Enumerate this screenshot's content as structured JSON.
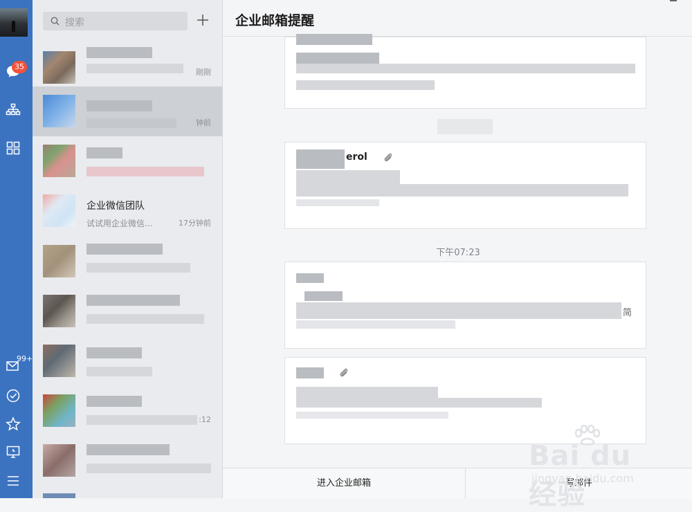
{
  "search": {
    "placeholder": "搜索"
  },
  "rail": {
    "messages_badge": "35",
    "mail_badge": "99+"
  },
  "conversations": [
    {
      "title": "",
      "subtitle": "",
      "time": "刚刚"
    },
    {
      "title": "",
      "subtitle": "",
      "time": "钟前"
    },
    {
      "title": "",
      "subtitle": "",
      "time": ""
    },
    {
      "title": "企业微信团队",
      "subtitle": "试试用企业微信...",
      "time": "17分钟前"
    },
    {
      "title": "",
      "subtitle": "",
      "time": ""
    },
    {
      "title": "",
      "subtitle": "",
      "time": ""
    },
    {
      "title": "",
      "subtitle": "",
      "time": ""
    },
    {
      "title": "",
      "subtitle": "",
      "time": ":12"
    },
    {
      "title": "",
      "subtitle": "",
      "time": ""
    }
  ],
  "main": {
    "title": "企业邮箱提醒",
    "card2_sender_fragment": "erol",
    "card3_edge_text": "简",
    "time_label": "下午07:23",
    "enter_mail_button": "进入企业邮箱",
    "compose_button": "写邮件"
  },
  "watermark": {
    "brand": "Bai du 经验",
    "url": "jingyan.baidu.com"
  },
  "colors": {
    "rail": "#3b73c0",
    "badge": "#f4523b",
    "list_bg": "#e9ebee",
    "selected_row": "#cdd0d5"
  }
}
